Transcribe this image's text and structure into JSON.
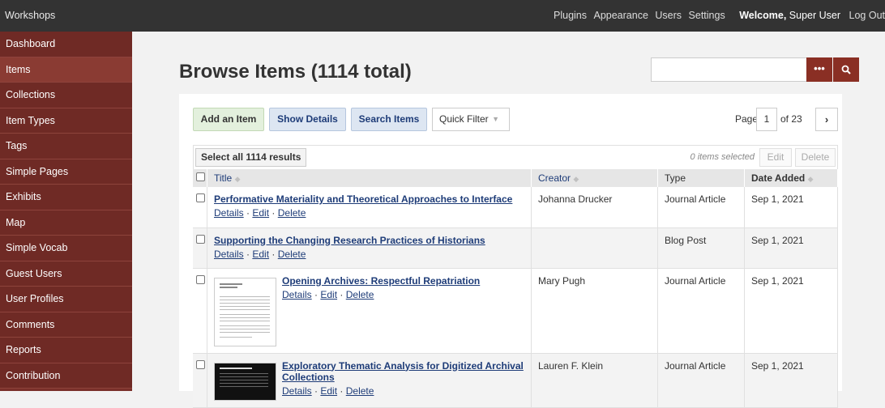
{
  "topbar": {
    "site_title": "Workshops",
    "nav": [
      "Plugins",
      "Appearance",
      "Users",
      "Settings"
    ],
    "welcome_prefix": "Welcome,",
    "welcome_user": "Super User",
    "logout": "Log Out"
  },
  "sidebar": {
    "items": [
      {
        "label": "Dashboard"
      },
      {
        "label": "Items"
      },
      {
        "label": "Collections"
      },
      {
        "label": "Item Types"
      },
      {
        "label": "Tags"
      },
      {
        "label": "Simple Pages"
      },
      {
        "label": "Exhibits"
      },
      {
        "label": "Map"
      },
      {
        "label": "Simple Vocab"
      },
      {
        "label": "Guest Users"
      },
      {
        "label": "User Profiles"
      },
      {
        "label": "Comments"
      },
      {
        "label": "Reports"
      },
      {
        "label": "Contribution"
      }
    ],
    "active": "Items"
  },
  "main": {
    "title": "Browse Items (1114 total)",
    "search_placeholder": "",
    "buttons": {
      "add": "Add an Item",
      "show_details": "Show Details",
      "search_items": "Search Items",
      "quick_filter": "Quick Filter"
    },
    "pager": {
      "label": "Page",
      "current": "1",
      "of": "of 23"
    },
    "batch": {
      "select_all": "Select all 1114 results",
      "selected": "0 items selected",
      "edit": "Edit",
      "delete": "Delete"
    },
    "columns": {
      "title": "Title",
      "creator": "Creator",
      "type": "Type",
      "date": "Date Added"
    },
    "rows": [
      {
        "title": "Performative Materiality and Theoretical Approaches to Interface",
        "creator": "Johanna Drucker",
        "type": "Journal Article",
        "date": "Sep 1, 2021"
      },
      {
        "title": "Supporting the Changing Research Practices of Historians",
        "creator": "",
        "type": "Blog Post",
        "date": "Sep 1, 2021"
      },
      {
        "title": "Opening Archives: Respectful Repatriation",
        "creator": "Mary Pugh",
        "type": "Journal Article",
        "date": "Sep 1, 2021"
      },
      {
        "title": "Exploratory Thematic Analysis for Digitized Archival Collections",
        "creator": "Lauren F. Klein",
        "type": "Journal Article",
        "date": "Sep 1, 2021"
      }
    ],
    "row_actions": {
      "details": "Details",
      "edit": "Edit",
      "delete": "Delete",
      "sep": "·"
    }
  },
  "colors": {
    "topbar": "#333333",
    "sidebar": "#6f2a25",
    "sidebar_active": "#8a3b33",
    "search_button": "#8a2f24",
    "link": "#1e3c78"
  }
}
